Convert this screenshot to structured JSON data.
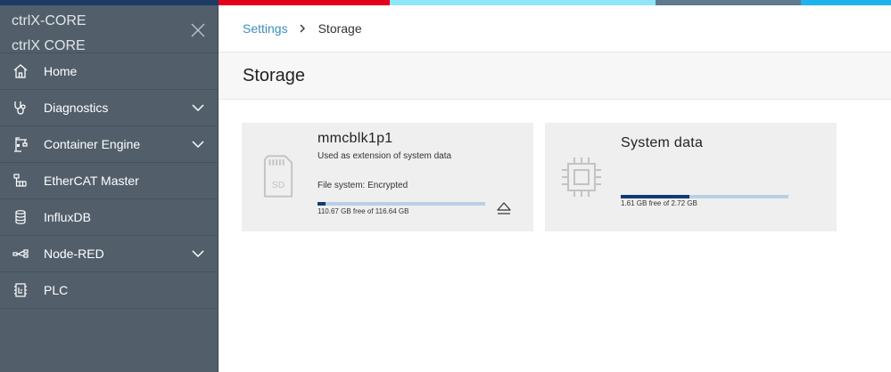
{
  "top_strip_colors": [
    "#1d3a62",
    "#e2001a",
    "#8fe6f9",
    "#5f7a8e",
    "#1eb3ee"
  ],
  "app": {
    "title_line1": "ctrlX-CORE",
    "title_line2": "ctrlX CORE"
  },
  "sidebar": {
    "items": [
      {
        "label": "Home",
        "icon": "home-icon",
        "expandable": false
      },
      {
        "label": "Diagnostics",
        "icon": "stethoscope-icon",
        "expandable": true
      },
      {
        "label": "Container Engine",
        "icon": "crane-icon",
        "expandable": true
      },
      {
        "label": "EtherCAT Master",
        "icon": "network-tree-icon",
        "expandable": false
      },
      {
        "label": "InfluxDB",
        "icon": "database-icon",
        "expandable": false
      },
      {
        "label": "Node-RED",
        "icon": "node-flow-icon",
        "expandable": true
      },
      {
        "label": "PLC",
        "icon": "plc-icon",
        "expandable": false
      }
    ]
  },
  "breadcrumb": {
    "parent": "Settings",
    "current": "Storage"
  },
  "page": {
    "title": "Storage"
  },
  "cards": {
    "sd": {
      "icon": "sd-card-icon",
      "icon_text": "SD",
      "name": "mmcblk1p1",
      "description": "Used as extension of system data",
      "filesystem": "File system: Encrypted",
      "free_text": "110.67 GB free of 116.64 GB",
      "used_fraction": 0.05,
      "action_icon": "eject-icon"
    },
    "system": {
      "icon": "chip-icon",
      "name": "System data",
      "free_text": "1.61 GB free of 2.72 GB",
      "used_fraction": 0.41
    }
  },
  "colors": {
    "sidebar_bg": "#525f6b",
    "link": "#3b8fc2",
    "bar_fill": "#0d3c73",
    "bar_track": "#b9cfe3"
  }
}
